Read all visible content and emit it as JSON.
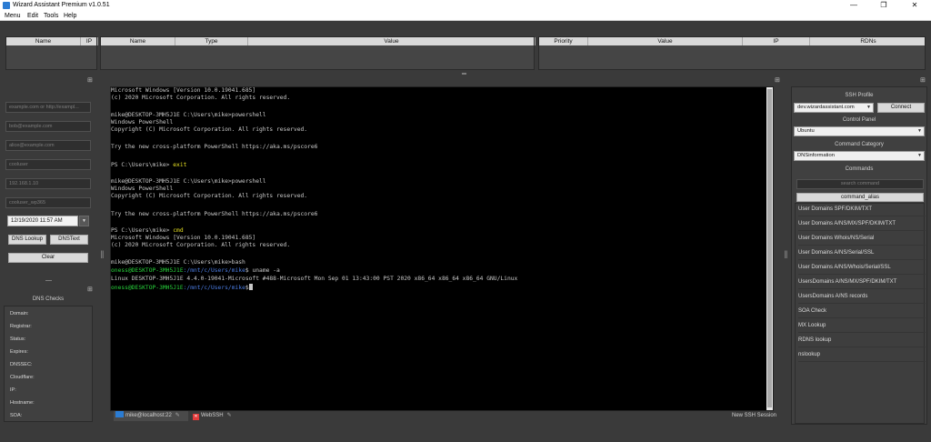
{
  "window": {
    "title": "Wizard Assistant Premium v1.0.51",
    "controls": [
      "—",
      "❐",
      "✕"
    ]
  },
  "menu": [
    "Menu",
    "Edit",
    "Tools",
    "Help"
  ],
  "left_table": {
    "headers": [
      "Name",
      "IP"
    ]
  },
  "mid_table": {
    "headers": [
      "Name",
      "Type",
      "Value"
    ]
  },
  "right_table": {
    "headers": [
      "Priority",
      "Value",
      "IP",
      "RDNs"
    ]
  },
  "inputs": {
    "domain_placeholder": "example.com or http://exampl...",
    "email1_placeholder": "bob@example.com",
    "email2_placeholder": "alice@example.com",
    "user_placeholder": "cooluser",
    "ip_placeholder": "192.168.1.10",
    "account_placeholder": "cooluser_wp365",
    "datetime": "12/19/2020 11:57 AM"
  },
  "buttons": {
    "dns_lookup": "DNS Lookup",
    "dns_text": "DNSText",
    "clear": "Clear"
  },
  "dns_checks": {
    "title": "DNS Checks",
    "labels": [
      "Domain:",
      "Registrar:",
      "Status:",
      "Expires:",
      "DNSSEC:",
      "Cloudflare:",
      "IP:",
      "Hostname:",
      "SOA:"
    ]
  },
  "terminal": {
    "lines": [
      "Microsoft Windows [Version 10.0.19041.685]",
      "(c) 2020 Microsoft Corporation. All rights reserved.",
      "",
      "mike@DESKTOP-3MH5J1E C:\\Users\\mike>powershell",
      "Windows PowerShell",
      "Copyright (C) Microsoft Corporation. All rights reserved.",
      "",
      "Try the new cross-platform PowerShell https://aka.ms/pscore6",
      "",
      "PS C:\\Users\\mike> ",
      "",
      "mike@DESKTOP-3MH5J1E C:\\Users\\mike>powershell",
      "Windows PowerShell",
      "Copyright (C) Microsoft Corporation. All rights reserved.",
      "",
      "Try the new cross-platform PowerShell https://aka.ms/pscore6",
      "",
      "PS C:\\Users\\mike> ",
      "Microsoft Windows [Version 10.0.19041.685]",
      "(c) 2020 Microsoft Corporation. All rights reserved.",
      "",
      "mike@DESKTOP-3MH5J1E C:\\Users\\mike>bash",
      "",
      "Linux DESKTOP-3MH5J1E 4.4.0-19041-Microsoft #488-Microsoft Mon Sep 01 13:43:00 PST 2020 x86_64 x86_64 x86_64 GNU/Linux",
      ""
    ],
    "ps_cmd_exit": "exit",
    "ps_cmd_cmd": "cmd",
    "bash_user": "oness@DESKTOP-3MH5J1E",
    "bash_path": ":/mnt/c/Users/mike",
    "bash_cmd1": "$ uname -a",
    "bash_prompt_end": "$"
  },
  "tabs": {
    "tab1": "mike@localhost:22",
    "tab2": "WebSSH",
    "new_session": "New SSH Session"
  },
  "right_panel": {
    "ssh_profile_label": "SSH Profile",
    "ssh_profile_value": "dev.wizardassistant.com",
    "connect": "Connect",
    "control_panel_label": "Control Panel",
    "control_panel_value": "Ubuntu",
    "command_category_label": "Command Category",
    "command_category_value": "DNSinformation",
    "commands_label": "Commands",
    "search_placeholder": "search command",
    "command_alias": "command_alias",
    "commands": [
      "User Domains SPF/DKIM/TXT",
      "User Domains A/NS/MX/SPF/DKIM/TXT",
      "User Domains Whois/NS/Serial",
      "User Domains A/NS/Serial/SSL",
      "User Domains A/NS/Whois/Serial/SSL",
      "UsersDomains A/NS/MX/SPF/DKIM/TXT",
      "UsersDomains A/NS records",
      "SOA Check",
      "MX Lookup",
      "RDNS lookup",
      "nslookup"
    ]
  },
  "colors": {
    "background": "#3a3a3a",
    "terminal_bg": "#000000",
    "prompt_green": "#28d43c",
    "path_blue": "#4b7de3",
    "command_yellow": "#e6e023"
  },
  "icons": [
    "app-icon",
    "minimize-icon",
    "maximize-icon",
    "close-icon",
    "terminal-tab-icon",
    "close-tab-icon",
    "dock-icon",
    "dropdown-arrow-icon",
    "calendar-icon"
  ]
}
